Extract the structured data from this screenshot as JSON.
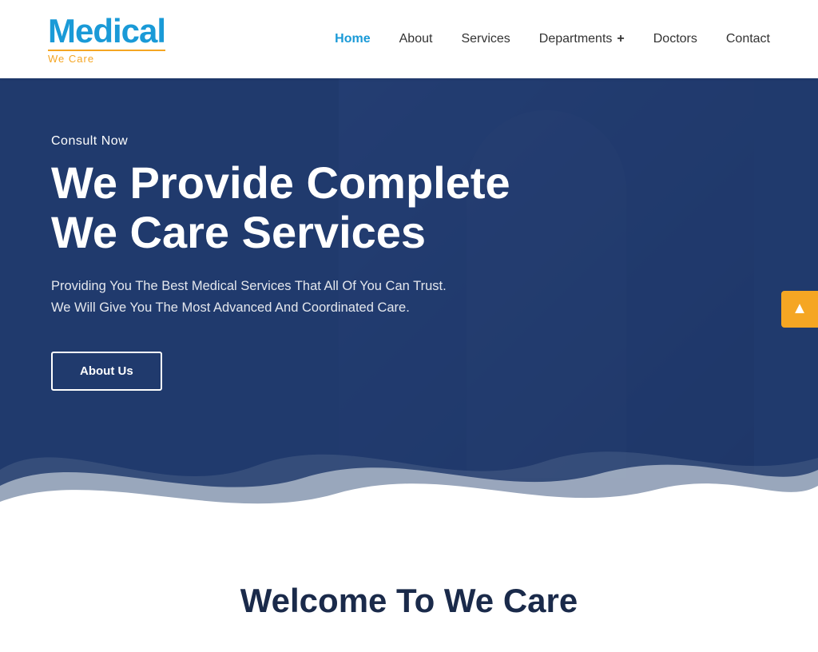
{
  "header": {
    "logo": {
      "text": "Medical",
      "tagline": "We Care"
    },
    "nav": {
      "items": [
        {
          "label": "Home",
          "active": true
        },
        {
          "label": "About",
          "active": false
        },
        {
          "label": "Services",
          "active": false
        },
        {
          "label": "Departments",
          "active": false,
          "has_plus": true
        },
        {
          "label": "Doctors",
          "active": false
        },
        {
          "label": "Contact",
          "active": false
        }
      ]
    }
  },
  "hero": {
    "consult_label": "Consult Now",
    "title_line1": "We Provide Complete",
    "title_line2": "We Care Services",
    "subtitle": "Providing You The Best Medical Services That All Of You Can Trust.\nWe Will Give You The Most Advanced And Coordinated Care.",
    "cta_label": "About Us"
  },
  "floating": {
    "icon": "▲"
  },
  "welcome": {
    "title": "Welcome To We Care"
  }
}
